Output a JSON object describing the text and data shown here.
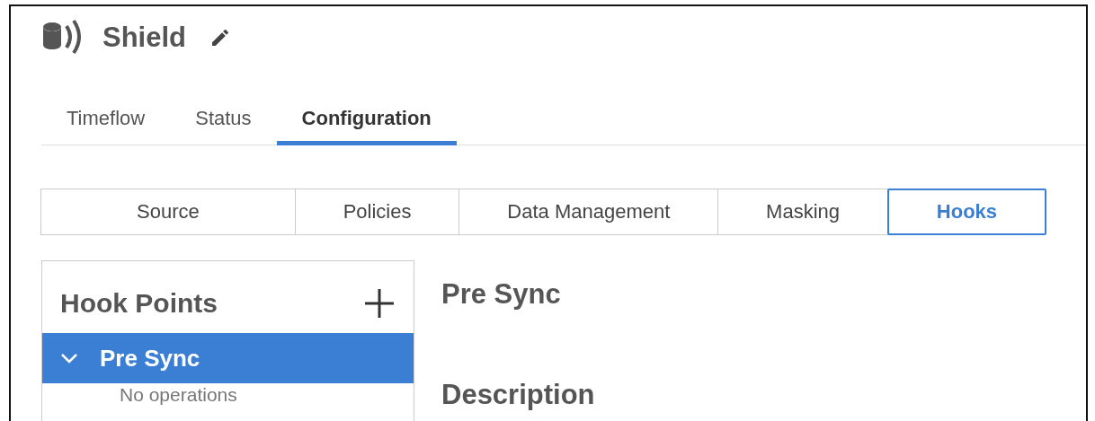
{
  "header": {
    "title": "Shield"
  },
  "tabs": [
    {
      "label": "Timeflow",
      "selected": false
    },
    {
      "label": "Status",
      "selected": false
    },
    {
      "label": "Configuration",
      "selected": true
    }
  ],
  "subtabs": [
    {
      "label": "Source",
      "selected": false
    },
    {
      "label": "Policies",
      "selected": false
    },
    {
      "label": "Data Management",
      "selected": false
    },
    {
      "label": "Masking",
      "selected": false
    },
    {
      "label": "Hooks",
      "selected": true
    }
  ],
  "hook_points": {
    "title": "Hook Points",
    "items": [
      {
        "label": "Pre Sync",
        "selected": true,
        "expanded": true,
        "empty_text": "No operations"
      }
    ]
  },
  "detail": {
    "title": "Pre Sync",
    "section": "Description"
  }
}
